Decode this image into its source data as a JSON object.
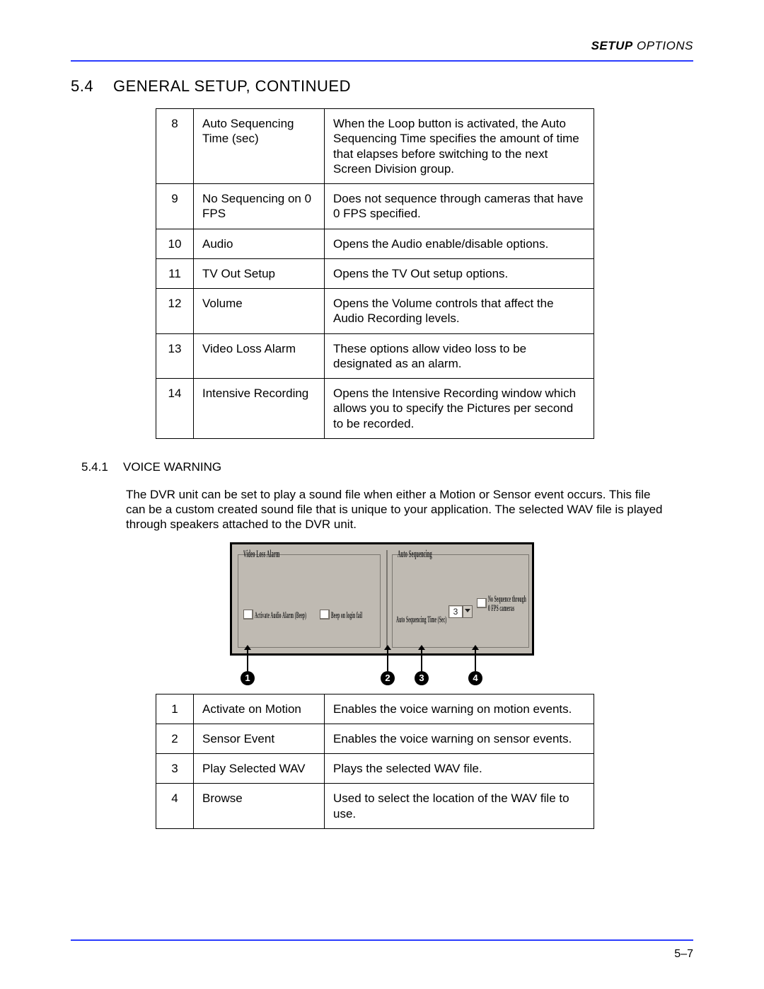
{
  "header": {
    "bold": "SETUP",
    "rest": " OPTIONS"
  },
  "section": {
    "number": "5.4",
    "title": "GENERAL SETUP, CONTINUED"
  },
  "table1": [
    {
      "n": "8",
      "name": "Auto Sequencing Time (sec)",
      "desc": "When the Loop button is activated, the Auto Sequencing Time specifies the amount of time that elapses before switching to the next Screen Division group."
    },
    {
      "n": "9",
      "name": "No Sequencing on 0 FPS",
      "desc": "Does not sequence through cameras that have 0 FPS specified."
    },
    {
      "n": "10",
      "name": "Audio",
      "desc": "Opens the Audio enable/disable options."
    },
    {
      "n": "11",
      "name": "TV Out Setup",
      "desc": "Opens the TV Out setup options."
    },
    {
      "n": "12",
      "name": "Volume",
      "desc": "Opens the Volume controls that affect the Audio Recording levels."
    },
    {
      "n": "13",
      "name": "Video Loss Alarm",
      "desc": "These options allow video loss to be designated as an alarm."
    },
    {
      "n": "14",
      "name": "Intensive Recording",
      "desc": "Opens the Intensive Recording window which allows you to specify the Pictures per second to be recorded."
    }
  ],
  "subsection": {
    "number": "5.4.1",
    "title": "VOICE WARNING"
  },
  "para": "The DVR unit can be set to play a sound file when either a Motion or Sensor event occurs. This file can be a custom created sound file that is unique to your application. The selected WAV file is played through speakers attached to the DVR unit.",
  "figure": {
    "left_group_label": "Video Loss Alarm",
    "right_group_label": "Auto Sequencing",
    "chk1_label": "Activate Audio Alarm (Beep)",
    "chk2_label": "Beep on login fail",
    "seq_time_label": "Auto Sequencing Time (Sec)",
    "seq_time_value": "3",
    "chk3_label": "No Sequence through 0 FPS cameras",
    "markers": [
      "1",
      "2",
      "3",
      "4"
    ]
  },
  "table2": [
    {
      "n": "1",
      "name": "Activate on Motion",
      "desc": "Enables the voice warning on motion events."
    },
    {
      "n": "2",
      "name": "Sensor Event",
      "desc": "Enables the voice warning on sensor events."
    },
    {
      "n": "3",
      "name": "Play Selected WAV",
      "desc": "Plays the selected WAV file."
    },
    {
      "n": "4",
      "name": "Browse",
      "desc": "Used to select the location of the WAV file to use."
    }
  ],
  "page_number": "5–7"
}
